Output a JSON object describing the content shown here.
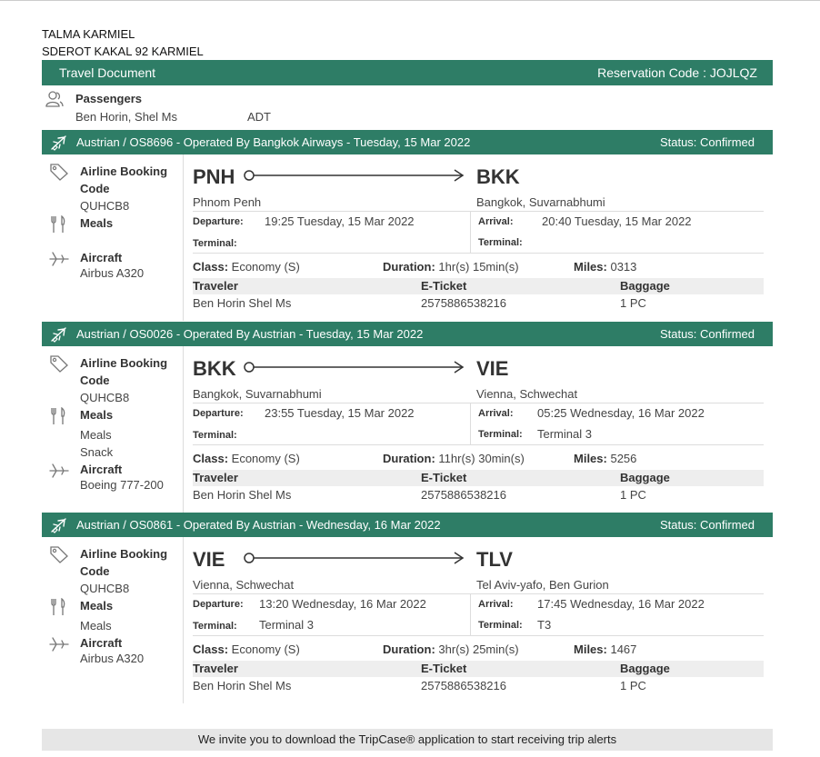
{
  "address": {
    "line1": "TALMA KARMIEL",
    "line2": "SDEROT KAKAL 92 KARMIEL"
  },
  "doc_bar": {
    "title": "Travel Document",
    "reservation": "Reservation Code : JOJLQZ"
  },
  "passengers": {
    "title": "Passengers",
    "names": "Ben Horin, Shel Ms",
    "type": "ADT"
  },
  "labels": {
    "booking_code": "Airline Booking Code",
    "meals": "Meals",
    "aircraft": "Aircraft",
    "departure": "Departure:",
    "arrival": "Arrival:",
    "terminal": "Terminal:",
    "class": "Class:",
    "duration": "Duration:",
    "miles": "Miles:",
    "traveler": "Traveler",
    "eticket": "E-Ticket",
    "baggage": "Baggage"
  },
  "segments": [
    {
      "title": "Austrian / OS8696 - Operated By Bangkok Airways - Tuesday, 15 Mar 2022",
      "status": "Status: Confirmed",
      "booking_code": "QUHCB8",
      "meals": [],
      "aircraft": "Airbus A320",
      "from_code": "PNH",
      "from_city": "Phnom Penh",
      "to_code": "BKK",
      "to_city": "Bangkok, Suvarnabhumi",
      "departure": "19:25 Tuesday, 15 Mar 2022",
      "arrival": "20:40 Tuesday, 15 Mar 2022",
      "dep_terminal": "",
      "arr_terminal": "",
      "class": "Economy (S)",
      "duration": "1hr(s) 15min(s)",
      "miles": "0313",
      "traveler": "Ben Horin Shel Ms",
      "eticket": "2575886538216",
      "baggage": "1 PC"
    },
    {
      "title": "Austrian / OS0026 - Operated By Austrian - Tuesday, 15 Mar 2022",
      "status": "Status: Confirmed",
      "booking_code": "QUHCB8",
      "meals": [
        "Meals",
        "Snack"
      ],
      "aircraft": "Boeing 777-200",
      "from_code": "BKK",
      "from_city": "Bangkok, Suvarnabhumi",
      "to_code": "VIE",
      "to_city": "Vienna, Schwechat",
      "departure": "23:55 Tuesday, 15 Mar 2022",
      "arrival": "05:25 Wednesday, 16 Mar 2022",
      "dep_terminal": "",
      "arr_terminal": "Terminal 3",
      "class": "Economy (S)",
      "duration": "11hr(s) 30min(s)",
      "miles": "5256",
      "traveler": "Ben Horin Shel Ms",
      "eticket": "2575886538216",
      "baggage": "1 PC"
    },
    {
      "title": "Austrian / OS0861 - Operated By Austrian - Wednesday, 16 Mar 2022",
      "status": "Status: Confirmed",
      "booking_code": "QUHCB8",
      "meals": [
        "Meals"
      ],
      "aircraft": "Airbus A320",
      "from_code": "VIE",
      "from_city": "Vienna, Schwechat",
      "to_code": "TLV",
      "to_city": "Tel Aviv-yafo, Ben Gurion",
      "departure": "13:20 Wednesday, 16 Mar 2022",
      "arrival": "17:45 Wednesday, 16 Mar 2022",
      "dep_terminal": "Terminal 3",
      "arr_terminal": "T3",
      "class": "Economy (S)",
      "duration": "3hr(s) 25min(s)",
      "miles": "1467",
      "traveler": "Ben Horin Shel Ms",
      "eticket": "2575886538216",
      "baggage": "1 PC"
    }
  ],
  "footer": "We invite you to download the TripCase® application to start receiving trip alerts",
  "colors": {
    "brand": "#2e7d66",
    "row_bg": "#eeeeee",
    "footer_bg": "#e6e6e6"
  }
}
